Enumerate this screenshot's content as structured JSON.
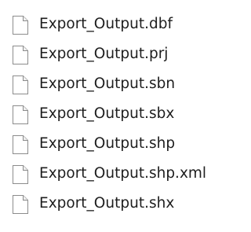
{
  "files": [
    {
      "name": "Export_Output.dbf",
      "icon": "blank-file-icon"
    },
    {
      "name": "Export_Output.prj",
      "icon": "blank-file-icon"
    },
    {
      "name": "Export_Output.sbn",
      "icon": "blank-file-icon"
    },
    {
      "name": "Export_Output.sbx",
      "icon": "blank-file-icon"
    },
    {
      "name": "Export_Output.shp",
      "icon": "blank-file-icon"
    },
    {
      "name": "Export_Output.shp.xml",
      "icon": "blank-file-icon"
    },
    {
      "name": "Export_Output.shx",
      "icon": "blank-file-icon"
    }
  ]
}
